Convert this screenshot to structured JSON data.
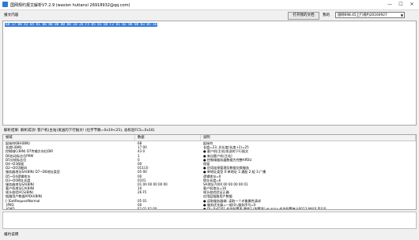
{
  "window": {
    "title": "国网规约报文解析V7.2.9 (wasion hutianxi 26918932@qq.com)",
    "minimize": "—",
    "maximize": "☐",
    "close": "✕"
  },
  "toolbar": {
    "content_label": "报文内容",
    "open_doc_button": "打开我的文档",
    "my_label": "我的",
    "my_select_value": "国网698.45上行规约20160927"
  },
  "input": {
    "hex": "68 17 00 43 05 01 00 00 00 00 00 10 26 F5 05 01 00 F2 01 02 00 00 03 05 16"
  },
  "result": {
    "summary": "解析结果: 解析成功! 客户机(主站)发送的下行报文! (位字节数=0x19<25), 总校验FCS=0x16)"
  },
  "table": {
    "headers": [
      "帧域",
      "数据",
      "说明"
    ],
    "rows": [
      [
        "起始符68H(BIN)",
        "68",
        "起始符"
      ],
      [
        "长度L(BIN)",
        "17 00",
        "长度=23, 总长度(长度+2)=25"
      ],
      [
        "控制域C(BIN)   D7传输方向位DIR",
        "43 0",
        "● 客户机(主站)发送的下行报文"
      ],
      [
        "               D6启动标志位PRM",
        "1",
        "● 来自客户机(主站)"
      ],
      [
        "               D5分帧标志位",
        "0",
        "● 控制域服务器数据为完整APDU"
      ],
      [
        "               D4~D3保留",
        "00",
        "保留"
      ],
      [
        "               D2~D0功能码",
        "011(3)",
        "● 应用连接管理及数据交换服务"
      ],
      [
        "服务器地址SA(BIN)  D7~D6地址类型",
        "05 00",
        "● 单地址类型 0:单地址 1:通配 2:组 3:广播"
      ],
      [
        "               D5~D4逻辑地址",
        "00",
        "逻辑地址=0"
      ],
      [
        "               D3~D0地址长度",
        "0101",
        "地址长度=6"
      ],
      [
        "服务器地址SA(BIN)",
        "01 00 00 00 00 00",
        "SA地址7000 00 00 00 00 01"
      ],
      [
        "客户机地址CA(BIN)",
        "10",
        "客户机地址=16"
      ],
      [
        "帧头校验HCS(BIN)",
        "26 F5",
        "帧头校验验证正确"
      ],
      [
        "   链路用户数据APDU(BIN)",
        "",
        "应用层链路用户数据"
      ],
      [
        "[-]GetRequestNormal",
        "05 01",
        "● 读取服务器端: 读取一个对象属性请求"
      ],
      [
        "  ├PIID",
        "00",
        "● 服务优先级=一般(0),服务序号=0"
      ],
      [
        "  └OAD",
        "F2 01 02 00",
        "● OI=0xF201 任务配置表 属性2 (配置表)  ⊞ arrsy 任务配置单元6013 特征0 索引0"
      ],
      [
        "[-]TimeTag",
        "00",
        "无时间标签"
      ],
      [
        "帧校验FCS(BIN)",
        "03 05",
        "帧校验验证正确"
      ],
      [
        "结束符16H(BIN)",
        "16",
        "结束符"
      ]
    ]
  },
  "status": {
    "label": "报约说明"
  }
}
